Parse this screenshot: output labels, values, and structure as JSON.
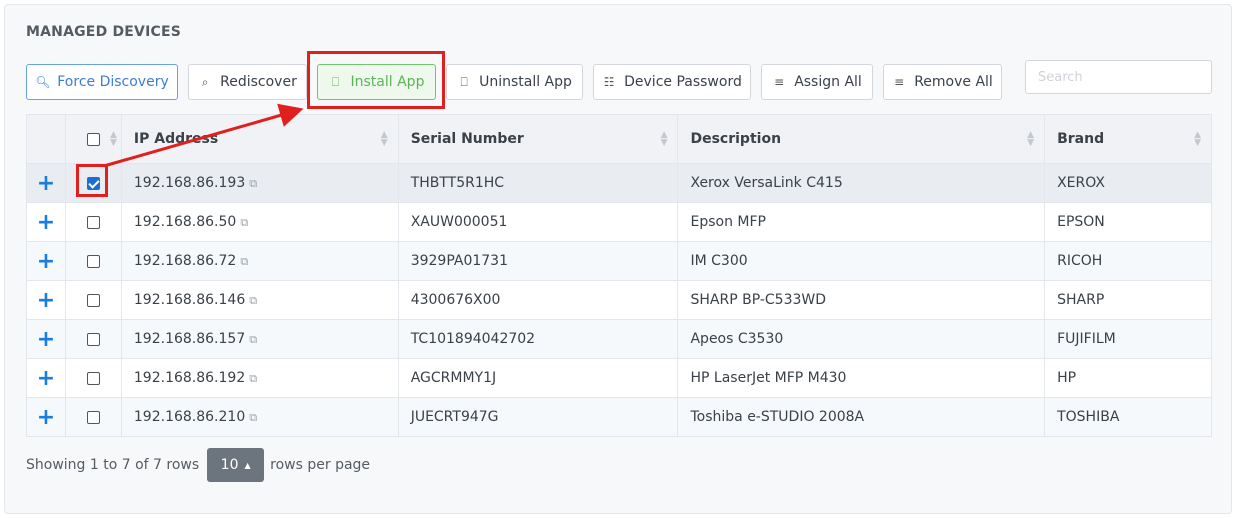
{
  "page": {
    "title": "MANAGED DEVICES"
  },
  "toolbar": {
    "force_discovery": "Force Discovery",
    "rediscover": "Rediscover",
    "install_app": "Install App",
    "uninstall_app": "Uninstall App",
    "device_password": "Device Password",
    "assign_all": "Assign All",
    "remove_all": "Remove All"
  },
  "search": {
    "placeholder": "Search",
    "value": ""
  },
  "table": {
    "columns": [
      "IP Address",
      "Serial Number",
      "Description",
      "Brand"
    ],
    "rows": [
      {
        "ip": "192.168.86.193",
        "serial": "THBTT5R1HC",
        "description": "Xerox VersaLink C415",
        "brand": "XEROX",
        "checked": true
      },
      {
        "ip": "192.168.86.50",
        "serial": "XAUW000051",
        "description": "Epson MFP",
        "brand": "EPSON",
        "checked": false
      },
      {
        "ip": "192.168.86.72",
        "serial": "3929PA01731",
        "description": "IM C300",
        "brand": "RICOH",
        "checked": false
      },
      {
        "ip": "192.168.86.146",
        "serial": "4300676X00",
        "description": "SHARP BP-C533WD",
        "brand": "SHARP",
        "checked": false
      },
      {
        "ip": "192.168.86.157",
        "serial": "TC101894042702",
        "description": "Apeos C3530",
        "brand": "FUJIFILM",
        "checked": false
      },
      {
        "ip": "192.168.86.192",
        "serial": "AGCRMMY1J",
        "description": "HP LaserJet MFP M430",
        "brand": "HP",
        "checked": false
      },
      {
        "ip": "192.168.86.210",
        "serial": "JUECRT947G",
        "description": "Toshiba e-STUDIO 2008A",
        "brand": "TOSHIBA",
        "checked": false
      }
    ]
  },
  "footer": {
    "showing": "Showing 1 to 7 of 7 rows",
    "page_size": "10",
    "rows_per_page": "rows per page"
  },
  "colors": {
    "accent": "#1a7de0",
    "success": "#5cb554",
    "annotation": "#e0201e"
  },
  "icons": {
    "force_discovery": "search-icon",
    "rediscover": "search-refresh-icon",
    "install_app": "install-icon",
    "uninstall_app": "uninstall-icon",
    "device_password": "password-icon",
    "assign_all": "playlist-add-icon",
    "remove_all": "playlist-remove-icon",
    "expand": "plus-icon",
    "external": "external-link-icon"
  }
}
